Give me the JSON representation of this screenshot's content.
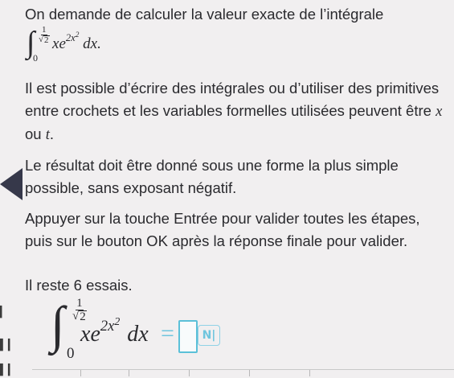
{
  "question": {
    "intro": "On demande de calculer la valeur exacte de l’intégrale",
    "instructions_1": "Il est possible d’écrire des intégrales ou d’utiliser des primitives entre crochets et les variables formelles utilisées peuvent être",
    "var_x": "x",
    "var_or": "ou",
    "var_t": "t",
    "instructions_2": "Le résultat doit être donné sous une forme la plus simple possible, sans exposant négatif.",
    "instructions_3": "Appuyer sur la touche Entrée pour valider toutes les étapes, puis sur le bouton OK après la réponse finale pour valider.",
    "remaining": "Il reste 6 essais."
  },
  "integral": {
    "sign": "∫",
    "upper_num": "1",
    "upper_den": "2",
    "sqrt_symbol": "√",
    "lower": "0",
    "x": "x",
    "e": "e",
    "exp_coef": "2",
    "exp_var": "x",
    "exp_pow": "2",
    "dx": "dx."
  },
  "answer_line": {
    "sign": "∫",
    "upper_num": "1",
    "upper_den": "2",
    "sqrt_symbol": "√",
    "lower": "0",
    "x": "x",
    "e": "e",
    "exp_coef": "2",
    "exp_var": "x",
    "exp_pow": "2",
    "dx": "dx",
    "equals": "=",
    "badge": "N|"
  },
  "colors": {
    "text": "#2a2a2e",
    "accent": "#5bc0d8",
    "background": "#f1eff0"
  }
}
